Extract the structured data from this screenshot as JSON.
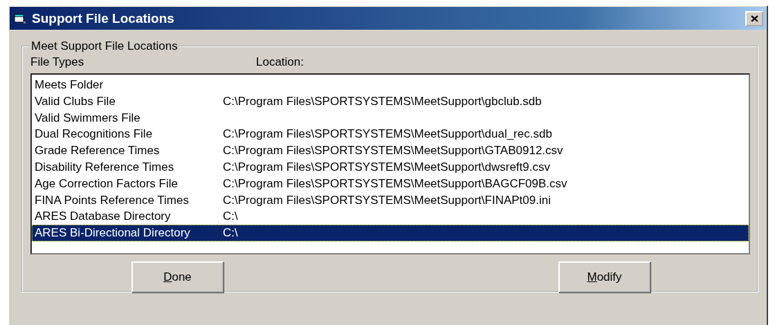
{
  "window": {
    "title": "Support File Locations"
  },
  "group": {
    "label": "Meet Support File Locations",
    "columns": [
      "File Types",
      "Location:"
    ],
    "rows": [
      {
        "file_type": "Meets Folder",
        "selected": false
      },
      {
        "file_type": "Valid Clubs File",
        "location": "C:\\Program Files\\SPORTSYSTEMS\\MeetSupport\\gbclub.sdb",
        "selected": false
      },
      {
        "file_type": "Valid Swimmers File",
        "selected": false
      },
      {
        "file_type": "Dual Recognitions File",
        "location": "C:\\Program Files\\SPORTSYSTEMS\\MeetSupport\\dual_rec.sdb",
        "selected": false
      },
      {
        "file_type": "Grade Reference Times",
        "location": "C:\\Program Files\\SPORTSYSTEMS\\MeetSupport\\GTAB0912.csv",
        "selected": false
      },
      {
        "file_type": "Disability Reference Times",
        "location": "C:\\Program Files\\SPORTSYSTEMS\\MeetSupport\\dwsreft9.csv",
        "selected": false
      },
      {
        "file_type": "Age Correction Factors File",
        "location": "C:\\Program Files\\SPORTSYSTEMS\\MeetSupport\\BAGCF09B.csv",
        "selected": false
      },
      {
        "file_type": "FINA Points Reference Times",
        "location": "C:\\Program Files\\SPORTSYSTEMS\\MeetSupport\\FINAPt09.ini",
        "selected": false
      },
      {
        "file_type": "ARES Database Directory",
        "location": "C:\\",
        "selected": false
      },
      {
        "file_type": "ARES Bi-Directional Directory",
        "location": "C:\\",
        "selected": true
      }
    ]
  },
  "buttons": [
    {
      "access_key": "D",
      "rest": "one"
    },
    {
      "access_key": "M",
      "rest": "odify"
    }
  ]
}
